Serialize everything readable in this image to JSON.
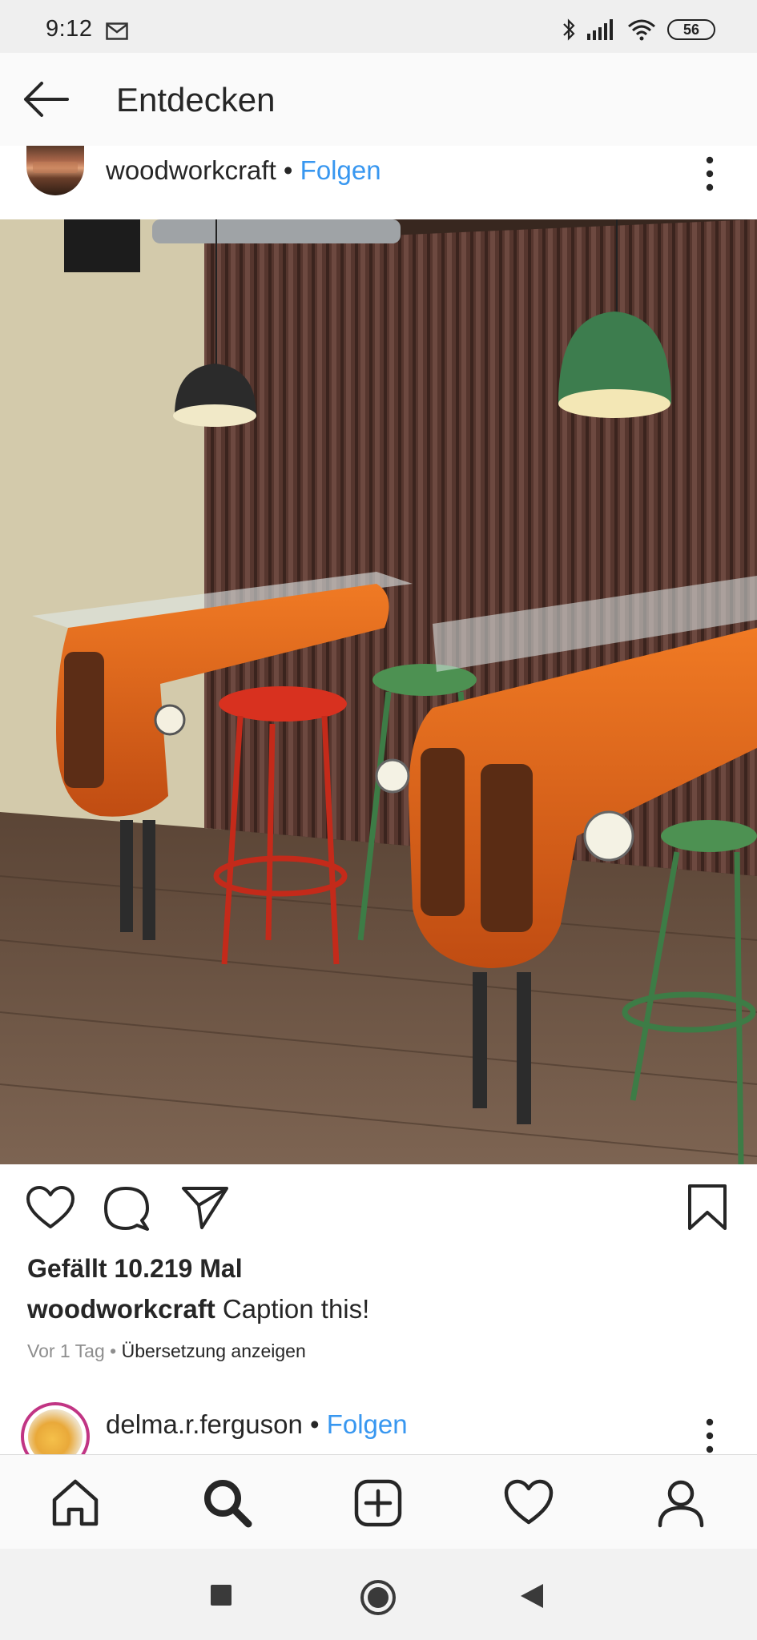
{
  "status_bar": {
    "time": "9:12",
    "battery": "56"
  },
  "header": {
    "title": "Entdecken"
  },
  "post": {
    "username": "woodworkcraft",
    "separator": "•",
    "follow_label": "Folgen",
    "likes_text": "Gefällt 10.219 Mal",
    "caption_user": "woodworkcraft",
    "caption_text": "Caption this!",
    "time_ago": "Vor 1 Tag",
    "meta_separator": "•",
    "translate_label": "Übersetzung anzeigen"
  },
  "next_post": {
    "username": "delma.r.ferguson",
    "separator": "•",
    "follow_label": "Folgen"
  },
  "bottom_nav": [
    "home-icon",
    "search-icon",
    "add-post-icon",
    "activity-heart-icon",
    "profile-icon"
  ],
  "colors": {
    "link_blue": "#3897f0",
    "text_dark": "#262626",
    "text_gray": "#8e8e8e"
  }
}
